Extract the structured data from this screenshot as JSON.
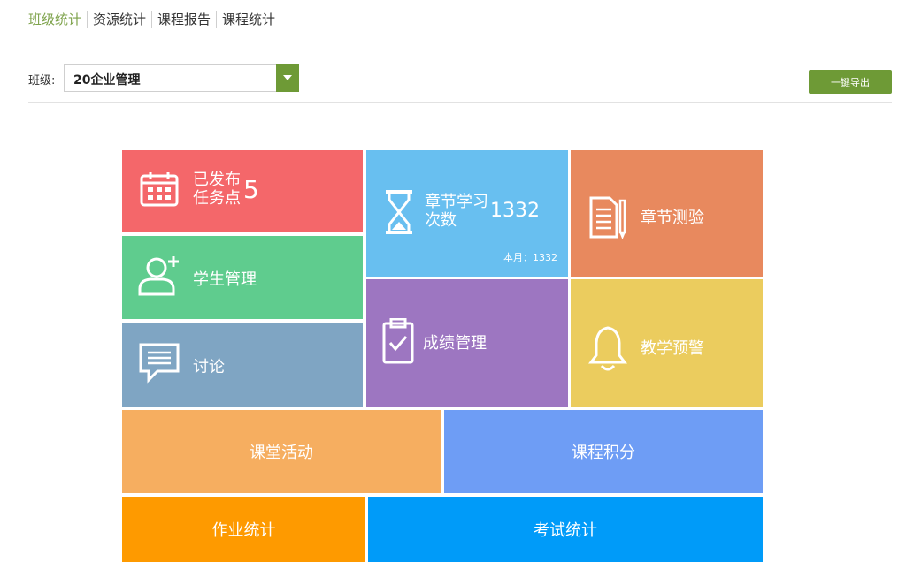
{
  "tabs": [
    "班级统计",
    "资源统计",
    "课程报告",
    "课程统计"
  ],
  "class_selector": {
    "label": "班级:",
    "value": "20企业管理"
  },
  "export_button": "一键导出",
  "tiles": {
    "published_tasks": {
      "label_line1": "已发布",
      "label_line2": "任务点",
      "value": "5"
    },
    "chapter_study": {
      "label_line1": "章节学习",
      "label_line2": "次数",
      "value": "1332",
      "month": "本月：1332"
    },
    "chapter_quiz": {
      "label": "章节测验"
    },
    "student_mgmt": {
      "label": "学生管理"
    },
    "grade_mgmt": {
      "label": "成绩管理"
    },
    "teaching_alert": {
      "label": "教学预警"
    },
    "discussion": {
      "label": "讨论"
    },
    "class_activity": {
      "label": "课堂活动"
    },
    "course_points": {
      "label": "课程积分"
    },
    "homework_stats": {
      "label": "作业统计"
    },
    "exam_stats": {
      "label": "考试统计"
    }
  },
  "colors": {
    "accent": "#6e9a36",
    "red": "#f4676a",
    "green": "#5fcc8e",
    "slate": "#7fa5c3",
    "sky": "#68bff0",
    "purple": "#9d76c1",
    "salmon": "#e8895e",
    "yellow": "#ebcc5e",
    "orange_light": "#f6ae60",
    "blue_light": "#6e9df5",
    "orange": "#fe9a00",
    "blue": "#009bf9"
  }
}
